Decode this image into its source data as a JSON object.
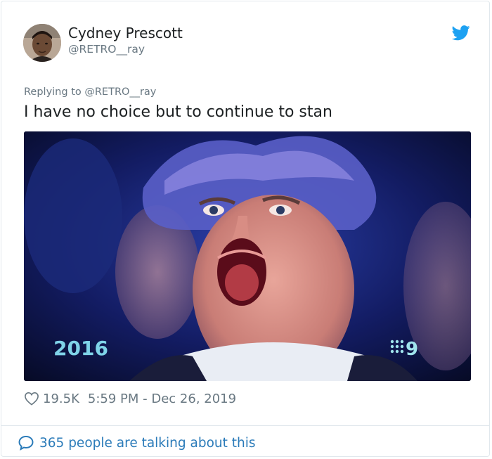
{
  "author": {
    "display_name": "Cydney Prescott",
    "handle": "@RETRO__ray"
  },
  "tweet": {
    "replying_to": "Replying to @RETRO__ray",
    "text": "I have no choice but to continue to stan"
  },
  "media": {
    "overlay_year": "2016",
    "overlay_channel": "9"
  },
  "footer": {
    "likes": "19.5K",
    "timestamp": "5:59 PM - Dec 26, 2019",
    "talking": "365 people are talking about this"
  },
  "icons": {
    "brand": "twitter-bird-icon",
    "like": "heart-icon",
    "reply": "speech-bubble-icon"
  },
  "colors": {
    "twitter_blue": "#1da1f2",
    "link_blue": "#2b7bb9",
    "muted_gray": "#697882",
    "text": "#1c2022"
  }
}
